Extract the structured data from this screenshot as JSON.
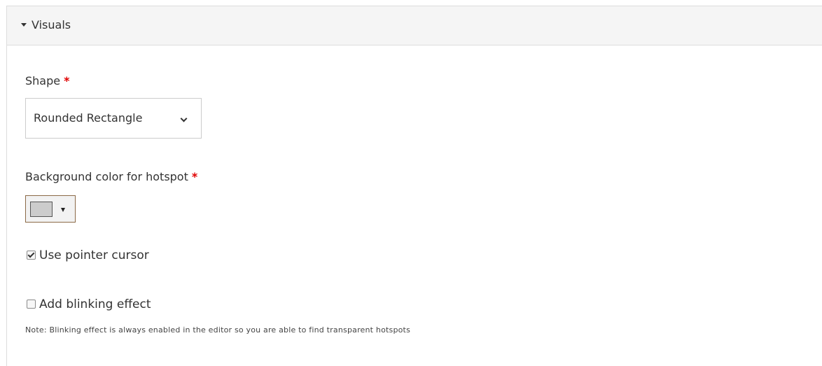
{
  "panel": {
    "title": "Visuals",
    "toggle_icon": "caret-down-icon"
  },
  "shape_field": {
    "label": "Shape",
    "required_mark": "*",
    "selected_value": "Rounded Rectangle",
    "dropdown_icon": "chevron-down-icon"
  },
  "background_color_field": {
    "label": "Background color for hotspot",
    "required_mark": "*",
    "swatch_color": "#cccccc",
    "dropdown_icon": "caret-down-icon"
  },
  "pointer_cursor": {
    "label": "Use pointer cursor",
    "checked": true
  },
  "blinking_effect": {
    "label": "Add blinking effect",
    "checked": false,
    "note": "Note: Blinking effect is always enabled in the editor so you are able to find transparent hotspots"
  },
  "colors": {
    "required": "#e00000",
    "header_background": "#f5f5f5",
    "border": "#dddddd"
  }
}
